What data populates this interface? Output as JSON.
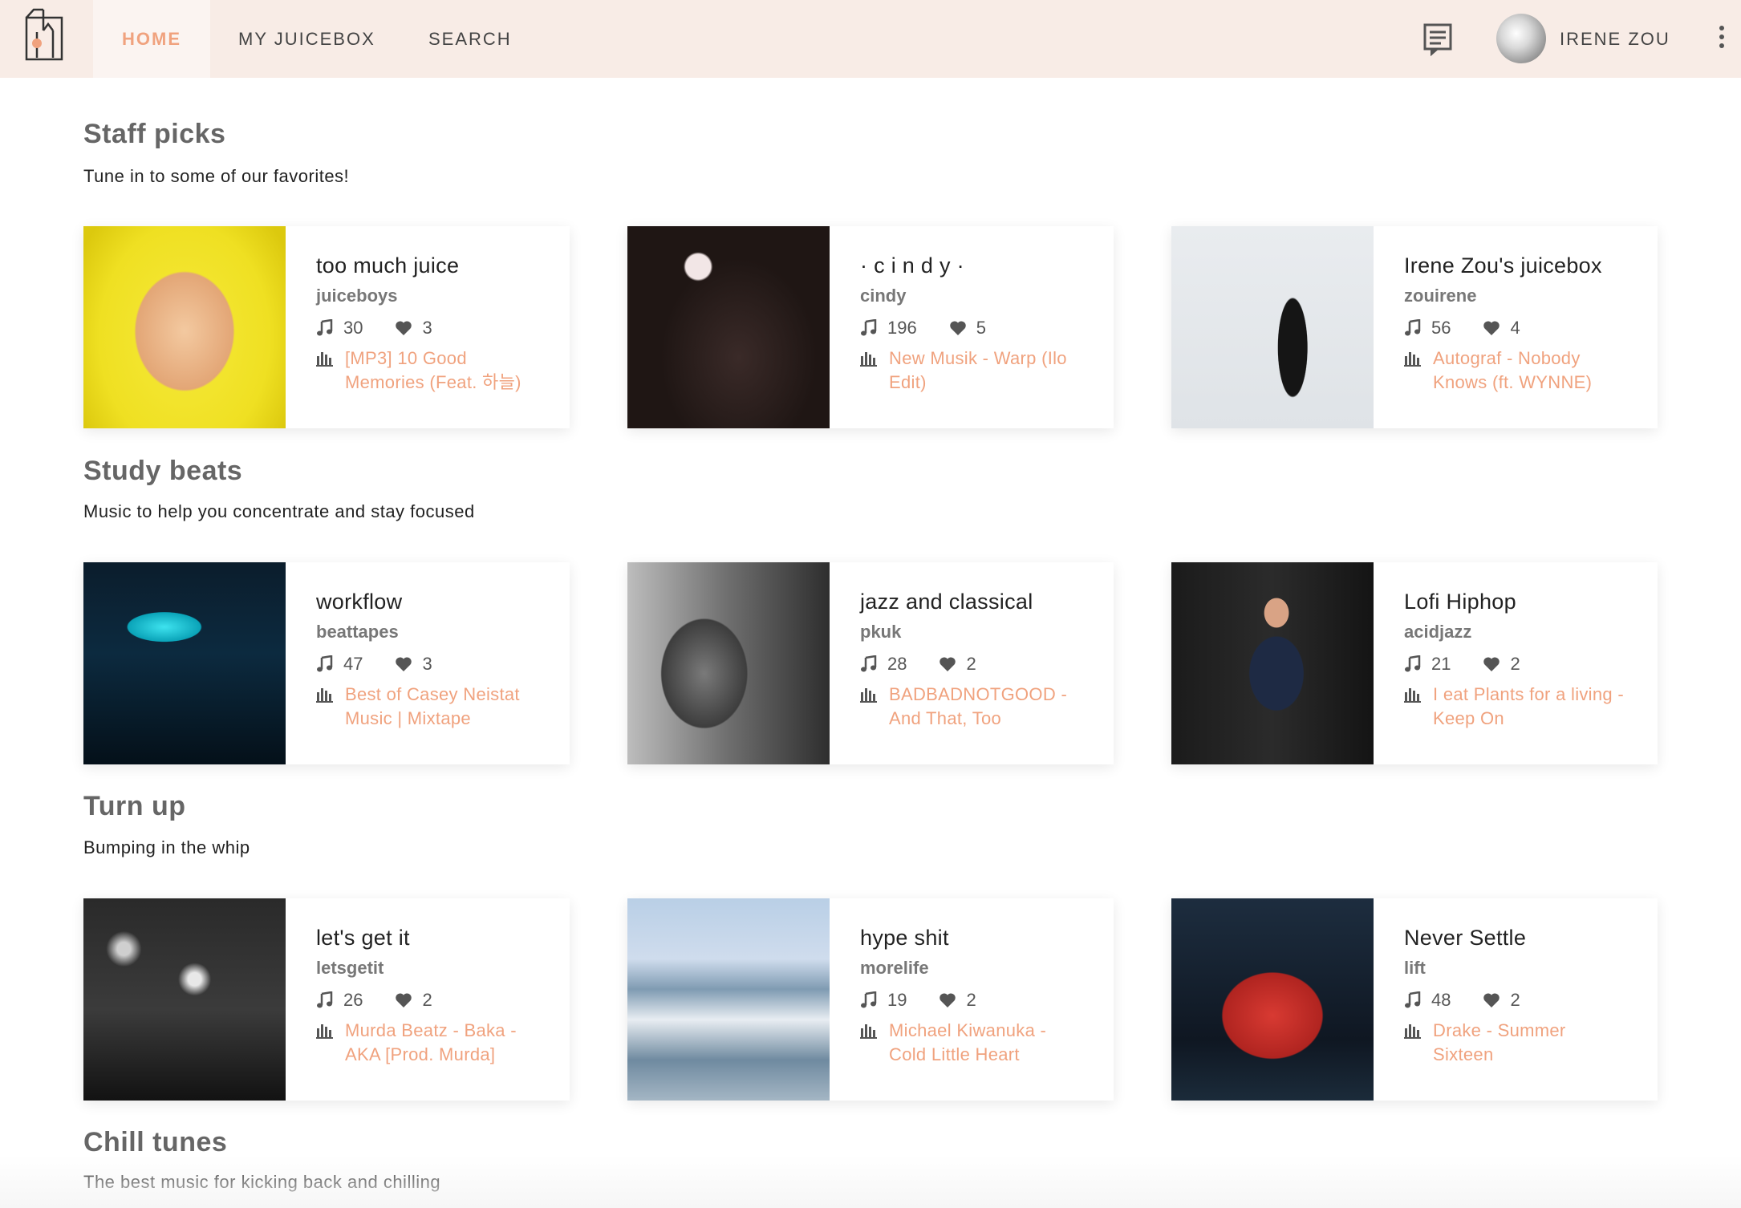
{
  "nav": {
    "tabs": [
      {
        "label": "HOME",
        "active": true
      },
      {
        "label": "MY JUICEBOX",
        "active": false
      },
      {
        "label": "SEARCH",
        "active": false
      }
    ],
    "username": "IRENE ZOU",
    "accent_color": "#f0a27e"
  },
  "sections": [
    {
      "title": "Staff picks",
      "subtitle": "Tune in to some of our favorites!",
      "cards": [
        {
          "title": "too much juice",
          "user": "juiceboys",
          "songs": "30",
          "likes": "3",
          "track": "[MP3] 10 Good Memories (Feat. 하늘)"
        },
        {
          "title": "· c i n d y ·",
          "user": "cindy",
          "songs": "196",
          "likes": "5",
          "track": "New Musik - Warp (Ilo Edit)"
        },
        {
          "title": "Irene Zou's juicebox",
          "user": "zouirene",
          "songs": "56",
          "likes": "4",
          "track": "Autograf - Nobody Knows (ft. WYNNE)"
        }
      ]
    },
    {
      "title": "Study beats",
      "subtitle": "Music to help you concentrate and stay focused",
      "cards": [
        {
          "title": "workflow",
          "user": "beattapes",
          "songs": "47",
          "likes": "3",
          "track": "Best of Casey Neistat Music | Mixtape"
        },
        {
          "title": "jazz and classical",
          "user": "pkuk",
          "songs": "28",
          "likes": "2",
          "track": "BADBADNOTGOOD - And That, Too"
        },
        {
          "title": "Lofi Hiphop",
          "user": "acidjazz",
          "songs": "21",
          "likes": "2",
          "track": "I eat Plants for a living - Keep On"
        }
      ]
    },
    {
      "title": "Turn up",
      "subtitle": "Bumping in the whip",
      "cards": [
        {
          "title": "let's get it",
          "user": "letsgetit",
          "songs": "26",
          "likes": "2",
          "track": "Murda Beatz - Baka - AKA [Prod. Murda]"
        },
        {
          "title": "hype shit",
          "user": "morelife",
          "songs": "19",
          "likes": "2",
          "track": "Michael Kiwanuka - Cold Little Heart"
        },
        {
          "title": "Never Settle",
          "user": "lift",
          "songs": "48",
          "likes": "2",
          "track": "Drake - Summer Sixteen"
        }
      ]
    },
    {
      "title": "Chill tunes",
      "subtitle": "The best music for kicking back and chilling",
      "cards": []
    }
  ]
}
